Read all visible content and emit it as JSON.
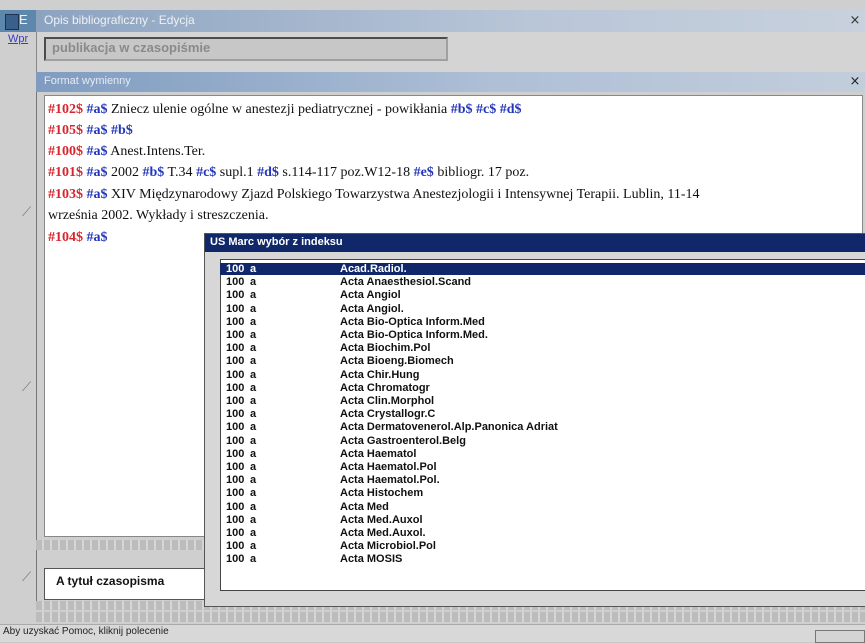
{
  "app": {
    "title_letter": "E",
    "menu": "Wpr"
  },
  "dialog": {
    "title": "Opis bibliograficzny - Edycja",
    "publication_type": "publikacja w czasopiśmie",
    "close": "×"
  },
  "format_window": {
    "title": "Format wymienny",
    "close": "×",
    "lines": [
      {
        "tag": "#102$",
        "parts": [
          [
            "sub",
            "#a$"
          ],
          [
            "txt",
            " Zniecz ulenie ogólne w anestezji pediatrycznej - powikłania "
          ],
          [
            "sub",
            "#b$"
          ],
          [
            "txt",
            "  "
          ],
          [
            "sub",
            "#c$"
          ],
          [
            "txt",
            "  "
          ],
          [
            "sub",
            "#d$"
          ]
        ]
      },
      {
        "tag": "#105$",
        "parts": [
          [
            "sub",
            "#a$"
          ],
          [
            "txt",
            "    "
          ],
          [
            "sub",
            "#b$"
          ]
        ]
      },
      {
        "tag": "#100$",
        "parts": [
          [
            "sub",
            "#a$"
          ],
          [
            "txt",
            " Anest.Intens.Ter."
          ]
        ]
      },
      {
        "tag": "#101$",
        "parts": [
          [
            "sub",
            "#a$"
          ],
          [
            "txt",
            " 2002 "
          ],
          [
            "sub",
            "#b$"
          ],
          [
            "txt",
            " T.34 "
          ],
          [
            "sub",
            "#c$"
          ],
          [
            "txt",
            " supl.1 "
          ],
          [
            "sub",
            "#d$"
          ],
          [
            "txt",
            " s.114-117 poz.W12-18 "
          ],
          [
            "sub",
            "#e$"
          ],
          [
            "txt",
            " bibliogr. 17 poz."
          ]
        ]
      },
      {
        "tag": "#103$",
        "parts": [
          [
            "sub",
            "#a$"
          ],
          [
            "txt",
            " XIV Międzynarodowy Zjazd Polskiego Towarzystwa Anestezjologii i Intensywnej Terapii. Lublin, 11-14"
          ]
        ]
      },
      {
        "tag": "",
        "parts": [
          [
            "txt",
            "września 2002. Wykłady i streszczenia."
          ]
        ]
      },
      {
        "tag": "#104$",
        "parts": [
          [
            "sub",
            "#a$"
          ]
        ]
      }
    ],
    "bottom_label": "A tytuł czasopisma"
  },
  "popup": {
    "title": "US Marc wybór z indeksu",
    "rows": [
      [
        "100",
        "a",
        "Acad.Radiol."
      ],
      [
        "100",
        "a",
        "Acta Anaesthesiol.Scand"
      ],
      [
        "100",
        "a",
        "Acta Angiol"
      ],
      [
        "100",
        "a",
        "Acta Angiol."
      ],
      [
        "100",
        "a",
        "Acta Bio-Optica Inform.Med"
      ],
      [
        "100",
        "a",
        "Acta Bio-Optica Inform.Med."
      ],
      [
        "100",
        "a",
        "Acta Biochim.Pol"
      ],
      [
        "100",
        "a",
        "Acta Bioeng.Biomech"
      ],
      [
        "100",
        "a",
        "Acta Chir.Hung"
      ],
      [
        "100",
        "a",
        "Acta Chromatogr"
      ],
      [
        "100",
        "a",
        "Acta Clin.Morphol"
      ],
      [
        "100",
        "a",
        "Acta Crystallogr.C"
      ],
      [
        "100",
        "a",
        "Acta Dermatovenerol.Alp.Panonica Adriat"
      ],
      [
        "100",
        "a",
        "Acta Gastroenterol.Belg"
      ],
      [
        "100",
        "a",
        "Acta Haematol"
      ],
      [
        "100",
        "a",
        "Acta Haematol.Pol"
      ],
      [
        "100",
        "a",
        "Acta Haematol.Pol."
      ],
      [
        "100",
        "a",
        "Acta Histochem"
      ],
      [
        "100",
        "a",
        "Acta Med"
      ],
      [
        "100",
        "a",
        "Acta Med.Auxol"
      ],
      [
        "100",
        "a",
        "Acta Med.Auxol."
      ],
      [
        "100",
        "a",
        "Acta Microbiol.Pol"
      ],
      [
        "100",
        "a",
        "Acta MOSIS"
      ]
    ],
    "selected_index": 0
  },
  "statusbar": {
    "text": "Aby uzyskać Pomoc, kliknij polecenie"
  },
  "colors": {
    "tag": "#d6262f",
    "subfield": "#2437b8",
    "selection": "#10286a"
  }
}
